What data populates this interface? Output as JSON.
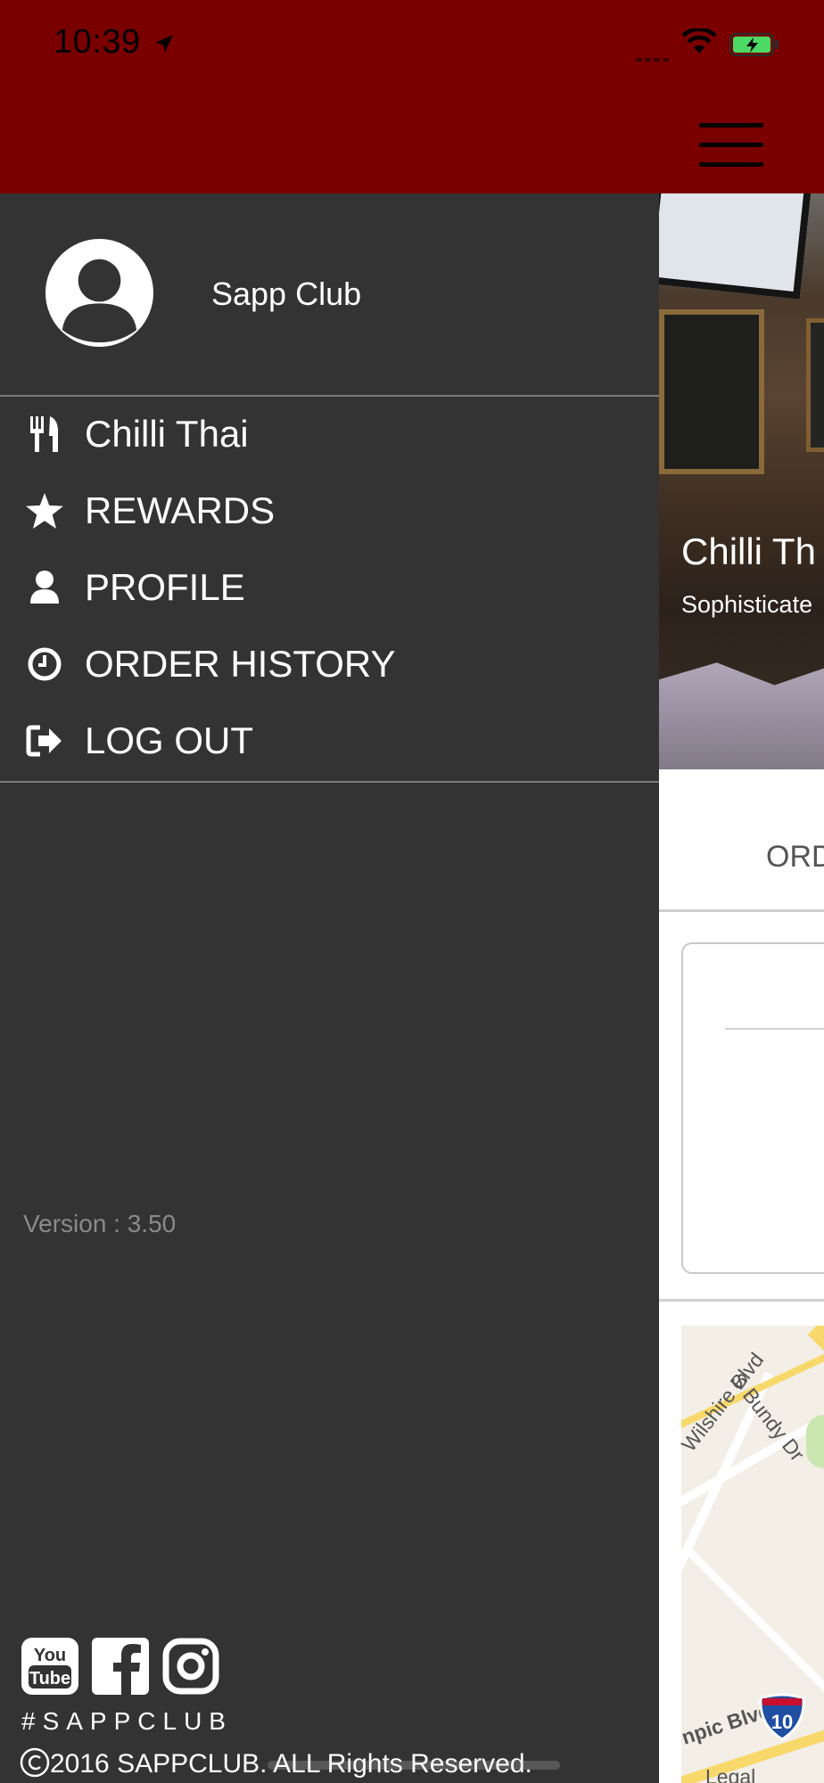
{
  "status_bar": {
    "time": "10:39",
    "icons": [
      "location-arrow-icon",
      "cellular-signal-icon",
      "wifi-icon",
      "battery-charging-icon"
    ]
  },
  "header": {
    "menu_icon": "hamburger-menu-icon",
    "background_color": "#7a0000"
  },
  "drawer": {
    "user": {
      "avatar_icon": "user-avatar-icon",
      "name": "Sapp Club"
    },
    "menu_items": [
      {
        "icon": "utensils-icon",
        "label": "Chilli Thai"
      },
      {
        "icon": "star-icon",
        "label": "REWARDS"
      },
      {
        "icon": "user-icon",
        "label": "PROFILE"
      },
      {
        "icon": "clock-icon",
        "label": "ORDER HISTORY"
      },
      {
        "icon": "sign-out-icon",
        "label": "LOG OUT"
      }
    ],
    "version": "Version : 3.50",
    "social_icons": [
      "youtube-icon",
      "facebook-icon",
      "instagram-icon"
    ],
    "hashtag": "#SAPPCLUB",
    "copyright": "2016 SAPPCLUB. ALL Rights Reserved.",
    "background_color": "#333333"
  },
  "content": {
    "restaurant_title": "Chilli Th",
    "restaurant_subtitle": "Sophisticate",
    "tab_label": "ORD",
    "map_labels": [
      "Wilshire Blvd",
      "S Bundy Dr",
      "npic Blvd",
      "Legal"
    ],
    "highway_number": "10"
  }
}
